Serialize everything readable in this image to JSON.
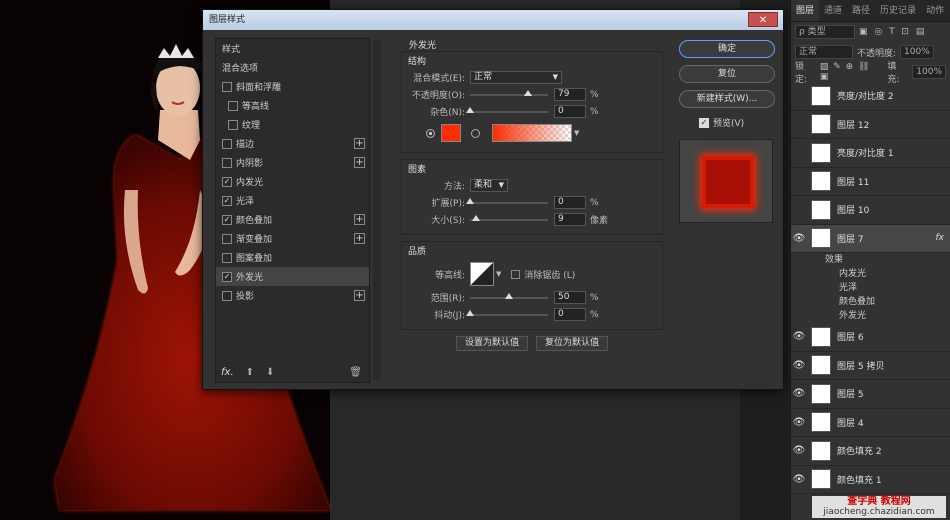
{
  "dialog": {
    "title": "图层样式",
    "close": "✕",
    "left_items": [
      {
        "label": "样式",
        "cb": false,
        "checked": false,
        "plus": false,
        "indent": false,
        "sel": false
      },
      {
        "label": "混合选项",
        "cb": false,
        "checked": false,
        "plus": false,
        "indent": false,
        "sel": false
      },
      {
        "label": "斜面和浮雕",
        "cb": true,
        "checked": false,
        "plus": false,
        "indent": false,
        "sel": false
      },
      {
        "label": "等高线",
        "cb": true,
        "checked": false,
        "plus": false,
        "indent": true,
        "sel": false
      },
      {
        "label": "纹理",
        "cb": true,
        "checked": false,
        "plus": false,
        "indent": true,
        "sel": false
      },
      {
        "label": "描边",
        "cb": true,
        "checked": false,
        "plus": true,
        "indent": false,
        "sel": false
      },
      {
        "label": "内阴影",
        "cb": true,
        "checked": false,
        "plus": true,
        "indent": false,
        "sel": false
      },
      {
        "label": "内发光",
        "cb": true,
        "checked": true,
        "plus": false,
        "indent": false,
        "sel": false
      },
      {
        "label": "光泽",
        "cb": true,
        "checked": true,
        "plus": false,
        "indent": false,
        "sel": false
      },
      {
        "label": "颜色叠加",
        "cb": true,
        "checked": true,
        "plus": true,
        "indent": false,
        "sel": false
      },
      {
        "label": "渐变叠加",
        "cb": true,
        "checked": false,
        "plus": true,
        "indent": false,
        "sel": false
      },
      {
        "label": "图案叠加",
        "cb": true,
        "checked": false,
        "plus": false,
        "indent": false,
        "sel": false
      },
      {
        "label": "外发光",
        "cb": true,
        "checked": true,
        "plus": false,
        "indent": false,
        "sel": true
      },
      {
        "label": "投影",
        "cb": true,
        "checked": false,
        "plus": true,
        "indent": false,
        "sel": false
      }
    ],
    "footer": {
      "fx": "fx.",
      "up": "⬆",
      "down": "⬇",
      "trash": "🗑"
    },
    "outer_glow_title": "外发光",
    "structure": {
      "title": "结构",
      "blend_label": "混合模式(E):",
      "blend_value": "正常",
      "opacity_label": "不透明度(O):",
      "opacity_value": "79",
      "noise_label": "杂色(N):",
      "noise_value": "0",
      "pct": "%",
      "glow_color": "#fc2c05"
    },
    "elements": {
      "title": "图素",
      "method_label": "方法:",
      "method_value": "柔和",
      "spread_label": "扩展(P):",
      "spread_value": "0",
      "size_label": "大小(S):",
      "size_value": "9",
      "size_unit": "像素",
      "pct": "%"
    },
    "quality": {
      "title": "品质",
      "contour_label": "等高线:",
      "antialias_label": "消除锯齿 (L)",
      "range_label": "范围(R):",
      "range_value": "50",
      "jitter_label": "抖动(J):",
      "jitter_value": "0",
      "pct": "%"
    },
    "default_buttons": {
      "set": "设置为默认值",
      "reset": "复位为默认值"
    },
    "buttons": {
      "ok": "确定",
      "reset": "复位",
      "new_style": "新建样式(W)...",
      "preview": "预览(V)"
    }
  },
  "panel": {
    "tabs": [
      "图层",
      "通道",
      "路径",
      "历史记录",
      "动作"
    ],
    "kind": "ρ 类型",
    "kind_icons": "▣ ◎ T ⊡ ▤",
    "blend": "正常",
    "opacity_label": "不透明度:",
    "opacity_value": "100%",
    "lock_label": "锁定:",
    "lock_icons": "▨ ✎ ⊕ ⛓ ▣",
    "fill_label": "填充:",
    "fill_value": "100%",
    "layers": [
      {
        "name": "亮度/对比度 2",
        "eye": false,
        "sel": false,
        "fx": ""
      },
      {
        "name": "图层 12",
        "eye": false,
        "sel": false,
        "fx": ""
      },
      {
        "name": "亮度/对比度 1",
        "eye": false,
        "sel": false,
        "fx": ""
      },
      {
        "name": "图层 11",
        "eye": false,
        "sel": false,
        "fx": ""
      },
      {
        "name": "图层 10",
        "eye": false,
        "sel": false,
        "fx": ""
      },
      {
        "name": "图层 7",
        "eye": true,
        "sel": true,
        "fx": "fx"
      }
    ],
    "effects_head": "效果",
    "effects": [
      "内发光",
      "光泽",
      "颜色叠加",
      "外发光"
    ],
    "layers2": [
      {
        "name": "图层 6",
        "eye": true
      },
      {
        "name": "图层 5 拷贝",
        "eye": true
      },
      {
        "name": "图层 5",
        "eye": true
      },
      {
        "name": "图层 4",
        "eye": true
      },
      {
        "name": "颜色填充 2",
        "eye": true
      },
      {
        "name": "颜色填充 1",
        "eye": true
      }
    ],
    "eye_glyph": "👁"
  },
  "watermark": {
    "line1": "查字典 教程网",
    "line2": "jiaocheng.chazidian.com"
  }
}
